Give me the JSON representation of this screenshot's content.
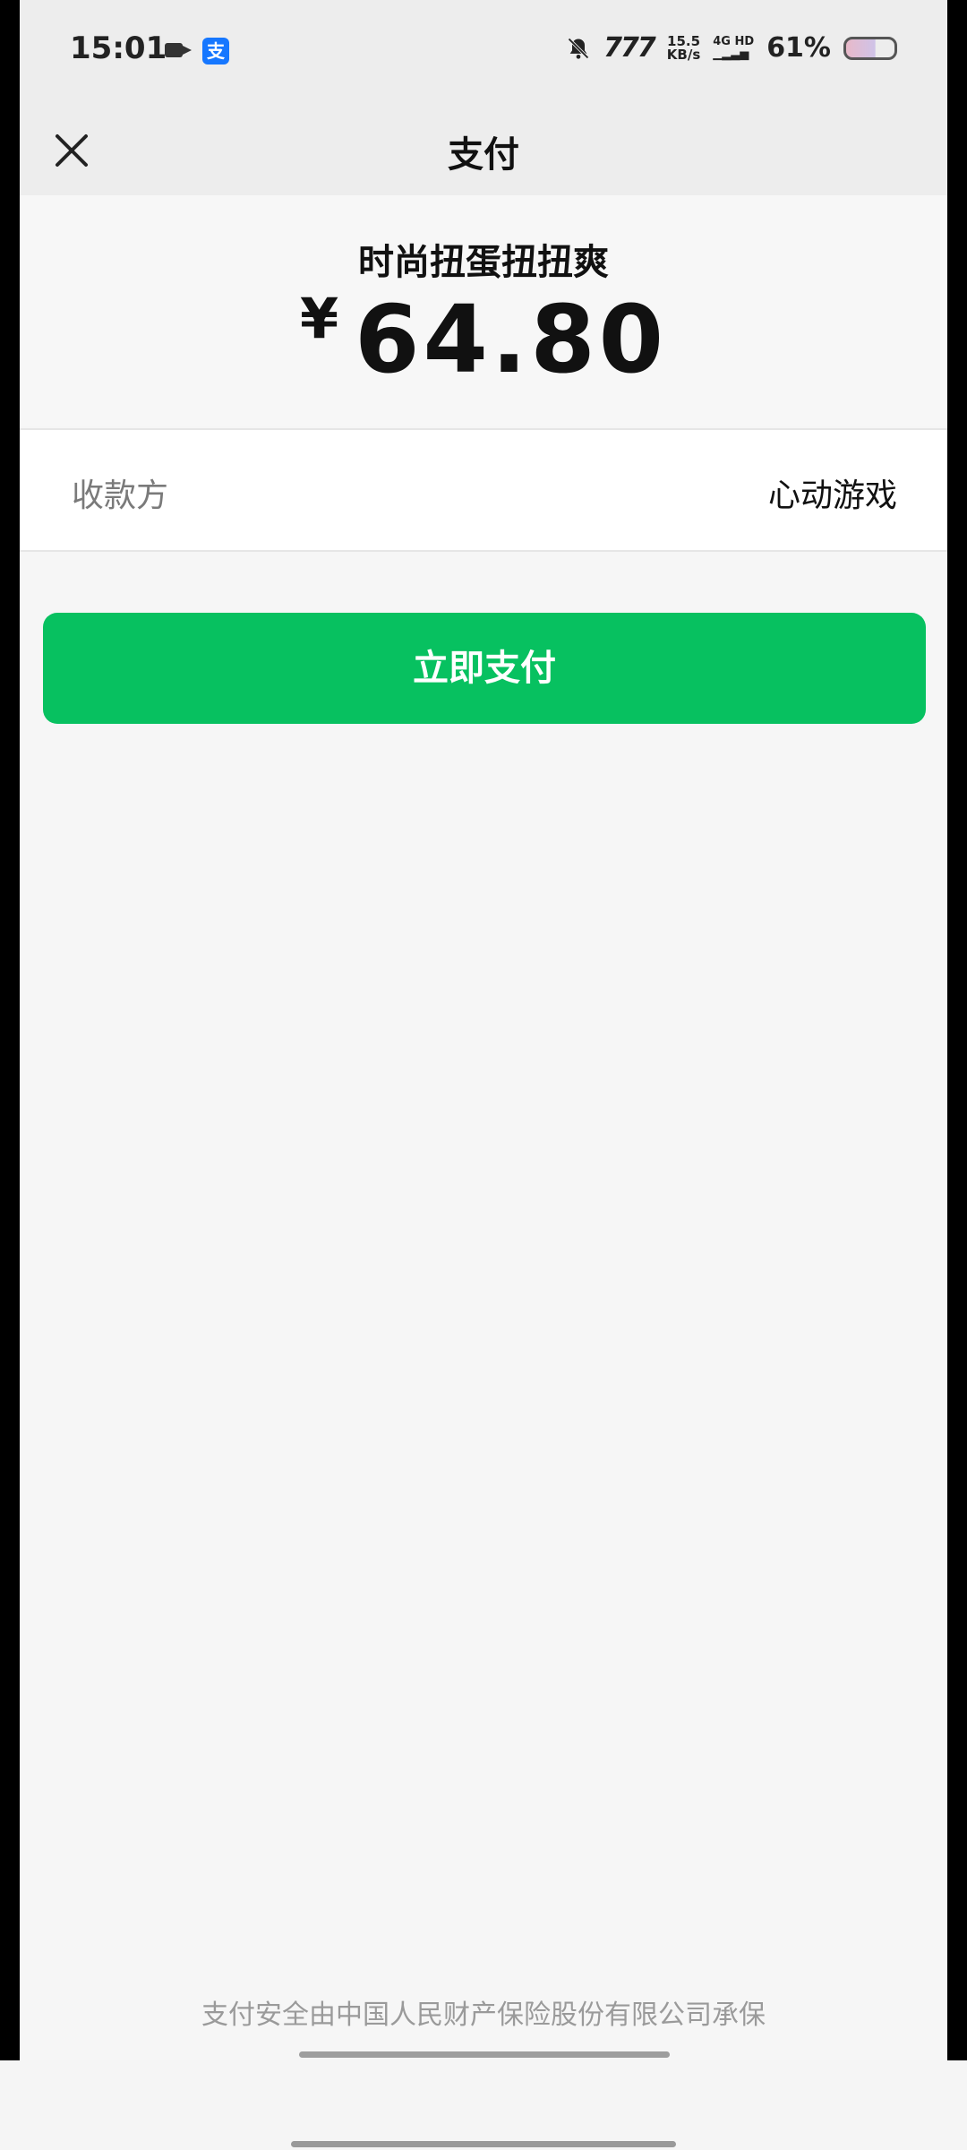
{
  "status_bar": {
    "time": "15:01",
    "app_badge": "支",
    "net_speed_top": "15.5",
    "net_speed_bottom": "KB/s",
    "signal_label": "4G HD",
    "speed_glyph": "777",
    "battery": "61%",
    "icons": [
      "video-camera-icon",
      "alipay-icon",
      "mute-bell-icon",
      "battery-icon"
    ]
  },
  "nav": {
    "title": "支付",
    "close_icon": "close-icon"
  },
  "order": {
    "product_name": "时尚扭蛋扭扭爽",
    "currency_symbol": "¥",
    "amount": "64.80"
  },
  "payee": {
    "label": "收款方",
    "value": "心动游戏"
  },
  "actions": {
    "pay_label": "立即支付"
  },
  "footer": {
    "note": "支付安全由中国人民财产保险股份有限公司承保"
  },
  "colors": {
    "accent": "#07c160",
    "background": "#f6f6f6",
    "nav_background": "#ededed"
  }
}
